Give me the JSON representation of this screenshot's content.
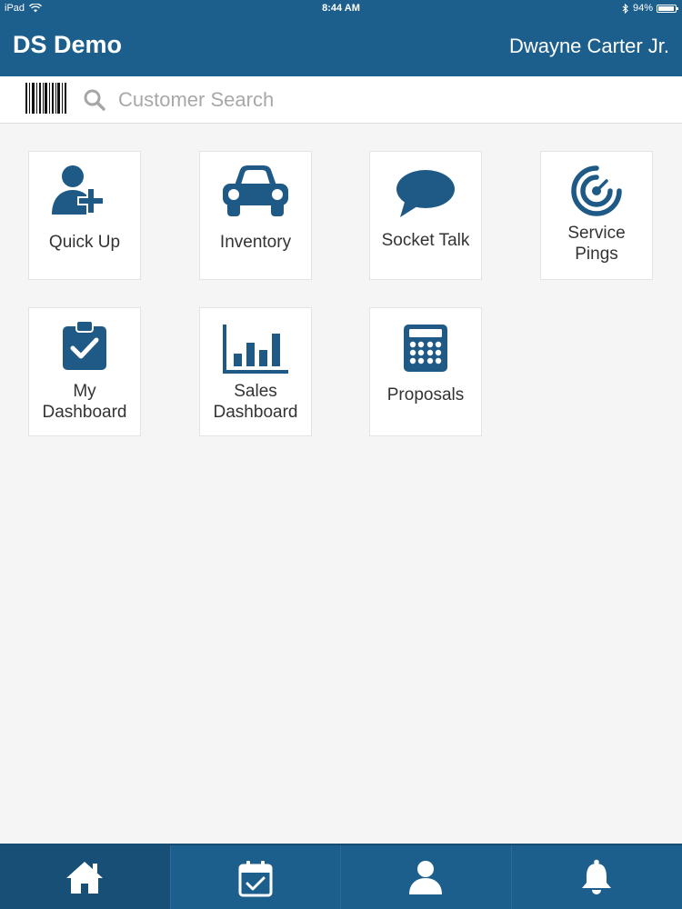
{
  "status_bar": {
    "device": "iPad",
    "time": "8:44 AM",
    "battery": "94%",
    "battery_level": 0.94
  },
  "header": {
    "title": "DS Demo",
    "user": "Dwayne Carter Jr."
  },
  "search": {
    "placeholder": "Customer Search",
    "value": ""
  },
  "tiles": [
    {
      "label": "Quick Up",
      "icon": "user-plus-icon"
    },
    {
      "label": "Inventory",
      "icon": "car-icon"
    },
    {
      "label": "Socket Talk",
      "icon": "speech-bubble-icon"
    },
    {
      "label": "Service\nPings",
      "icon": "radar-icon"
    },
    {
      "label": "My\nDashboard",
      "icon": "clipboard-check-icon"
    },
    {
      "label": "Sales\nDashboard",
      "icon": "bar-chart-icon"
    },
    {
      "label": "Proposals",
      "icon": "calculator-icon"
    }
  ],
  "tab_bar": [
    {
      "icon": "home-icon",
      "active": true
    },
    {
      "icon": "calendar-check-icon",
      "active": false
    },
    {
      "icon": "person-icon",
      "active": false
    },
    {
      "icon": "bell-icon",
      "active": false
    }
  ],
  "colors": {
    "primary": "#1d5f8c",
    "icon_blue": "#1f5a86",
    "background": "#f5f5f6"
  }
}
